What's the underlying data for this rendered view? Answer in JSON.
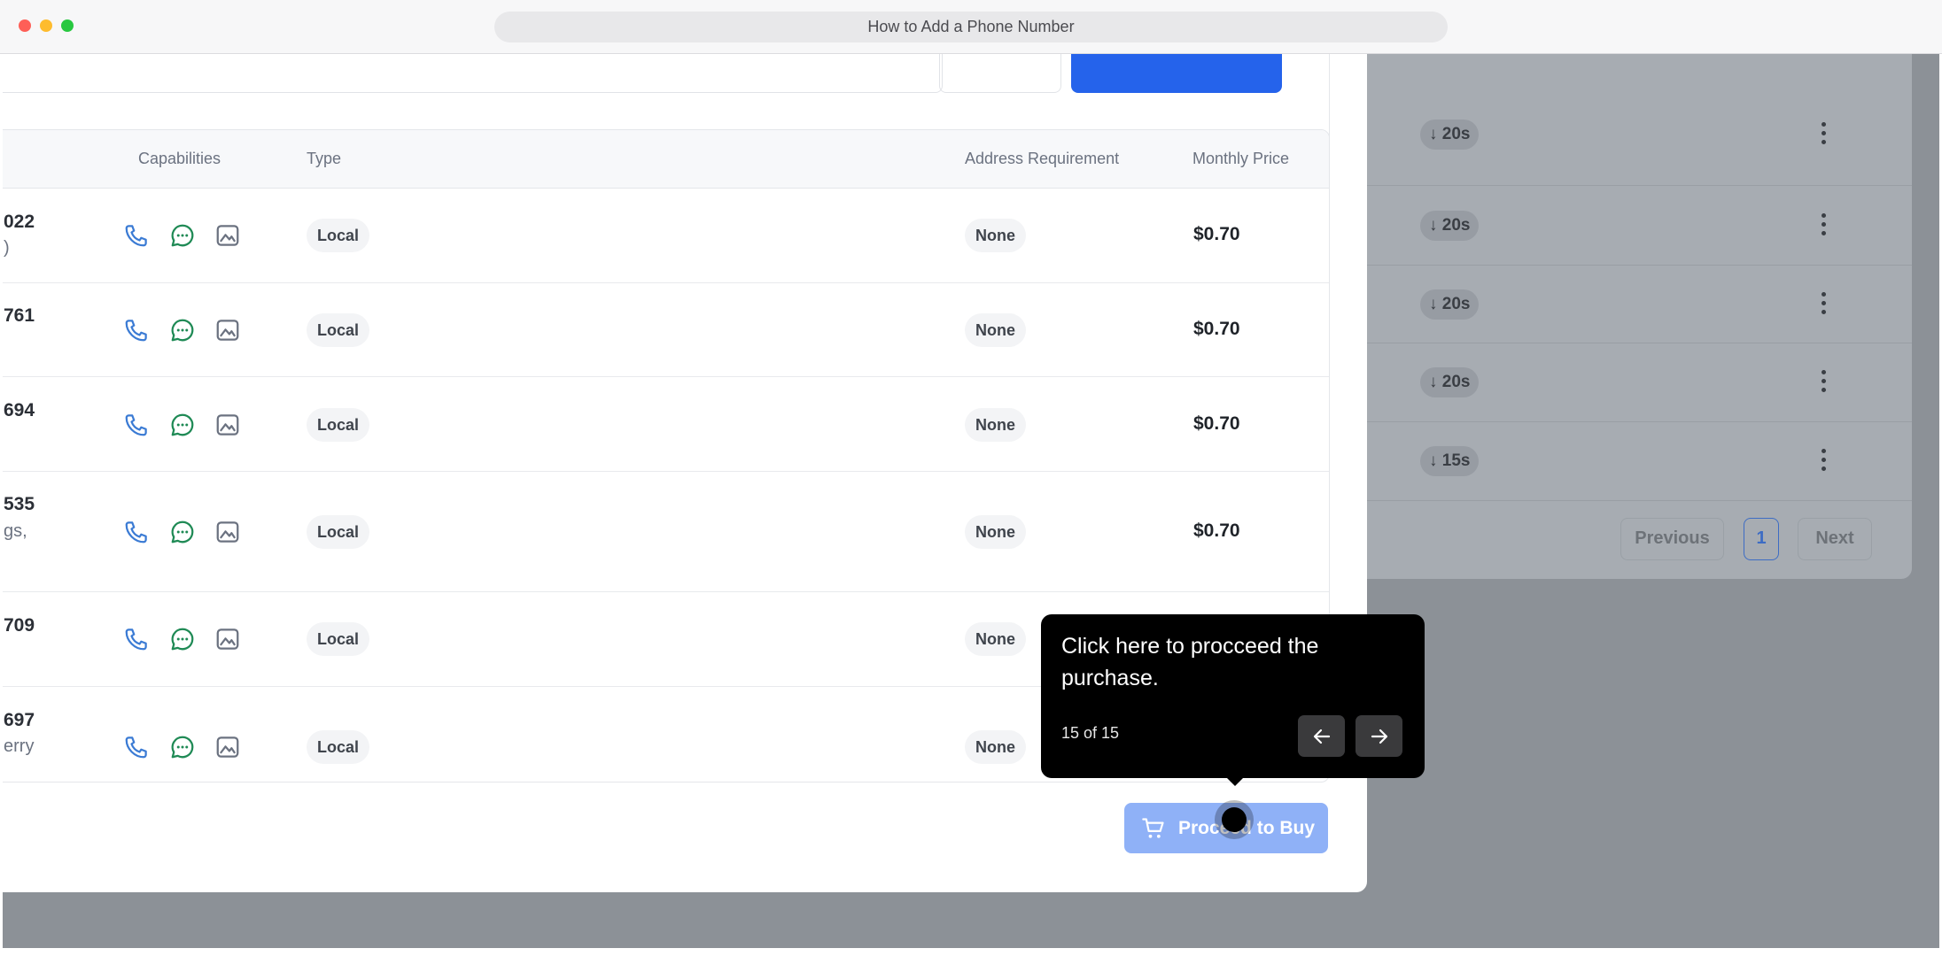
{
  "window": {
    "title": "How to Add a Phone Number"
  },
  "background": {
    "badges": [
      "↓ 20s",
      "↓ 20s",
      "↓ 20s",
      "↓ 20s",
      "↓ 15s"
    ],
    "pagination": {
      "previous": "Previous",
      "current": "1",
      "next": "Next"
    }
  },
  "table": {
    "headers": {
      "capabilities": "Capabilities",
      "type": "Type",
      "address": "Address Requirement",
      "price": "Monthly Price"
    },
    "rows": [
      {
        "number": "022",
        "location": ")",
        "type": "Local",
        "address": "None",
        "price": "$0.70"
      },
      {
        "number": "761",
        "location": "",
        "type": "Local",
        "address": "None",
        "price": "$0.70"
      },
      {
        "number": "694",
        "location": "",
        "type": "Local",
        "address": "None",
        "price": "$0.70"
      },
      {
        "number": "535",
        "location": "gs,",
        "type": "Local",
        "address": "None",
        "price": "$0.70"
      },
      {
        "number": "709",
        "location": "",
        "type": "Local",
        "address": "None",
        "price": ""
      },
      {
        "number": "697",
        "location": "erry",
        "type": "Local",
        "address": "None",
        "price": ""
      }
    ],
    "capability_icons": [
      "phone-icon",
      "message-icon",
      "image-icon"
    ]
  },
  "proceed_button": {
    "label": "Proceed to Buy",
    "icon": "cart-icon"
  },
  "tour": {
    "text": "Click here to procceed the purchase.",
    "step": "15 of 15"
  },
  "colors": {
    "primary": "#2563eb",
    "phone": "#3b7bd4",
    "message": "#1f8a55",
    "image": "#6b7280"
  }
}
